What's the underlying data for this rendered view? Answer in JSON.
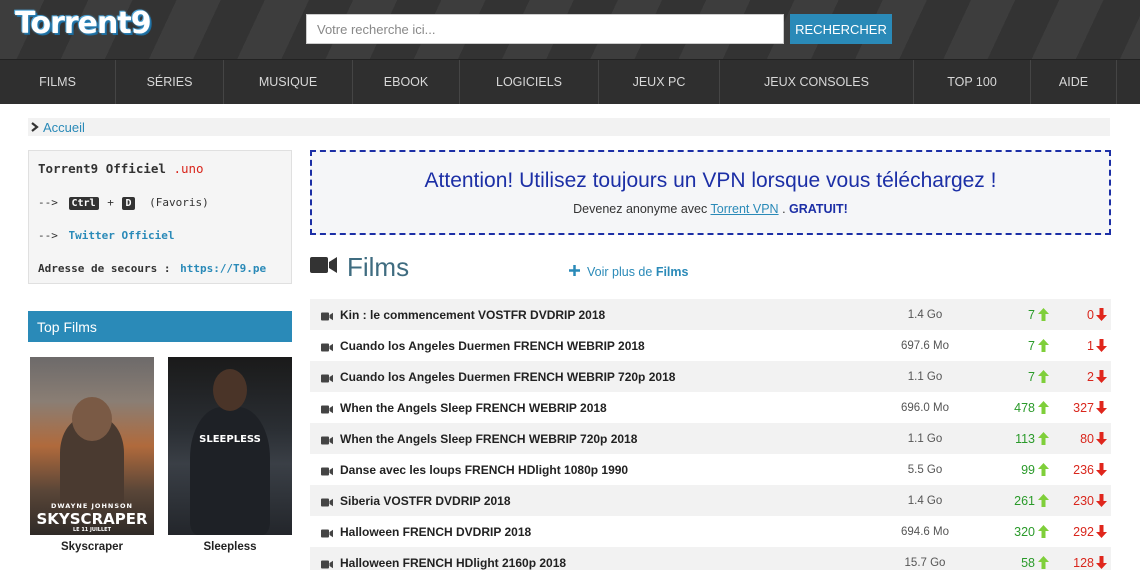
{
  "header": {
    "logo": "Torrent9",
    "search_placeholder": "Votre recherche ici...",
    "search_button": "RECHERCHER"
  },
  "nav": [
    "FILMS",
    "SÉRIES",
    "MUSIQUE",
    "EBOOK",
    "LOGICIELS",
    "JEUX PC",
    "JEUX CONSOLES",
    "TOP 100",
    "AIDE"
  ],
  "breadcrumb": {
    "label": "Accueil"
  },
  "infobox": {
    "title": "Torrent9 Officiel",
    "title_suffix": ".uno",
    "fav_prefix": "-->",
    "key_ctrl": "Ctrl",
    "plus": "+",
    "key_d": "D",
    "fav_label": "(Favoris)",
    "twitter_prefix": "-->",
    "twitter_label": "Twitter Officiel",
    "backup_label": "Adresse de secours :",
    "backup_url": "https://T9.pe"
  },
  "top_films": {
    "heading": "Top Films",
    "items": [
      {
        "caption": "Skyscraper",
        "poster_top": "DWAYNE JOHNSON",
        "poster_title": "SKYSCRAPER",
        "poster_sub": "LE 11 JUILLET"
      },
      {
        "caption": "Sleepless",
        "poster_title": "SLEEPLESS"
      }
    ]
  },
  "vpn": {
    "title": "Attention! Utilisez toujours un VPN lorsque vous téléchargez !",
    "sub_before": "Devenez anonyme avec",
    "link": "Torrent VPN",
    "sub_mid": ".",
    "free": "GRATUIT!"
  },
  "films": {
    "heading": "Films",
    "more_prefix": "Voir plus de",
    "more_bold": "Films"
  },
  "torrents": [
    {
      "title": "Kin : le commencement VOSTFR DVDRIP 2018",
      "size": "1.4 Go",
      "seeders": "7",
      "leechers": "0"
    },
    {
      "title": "Cuando los Angeles Duermen FRENCH WEBRIP 2018",
      "size": "697.6 Mo",
      "seeders": "7",
      "leechers": "1"
    },
    {
      "title": "Cuando los Angeles Duermen FRENCH WEBRIP 720p 2018",
      "size": "1.1 Go",
      "seeders": "7",
      "leechers": "2"
    },
    {
      "title": "When the Angels Sleep FRENCH WEBRIP 2018",
      "size": "696.0 Mo",
      "seeders": "478",
      "leechers": "327"
    },
    {
      "title": "When the Angels Sleep FRENCH WEBRIP 720p 2018",
      "size": "1.1 Go",
      "seeders": "113",
      "leechers": "80"
    },
    {
      "title": "Danse avec les loups FRENCH HDlight 1080p 1990",
      "size": "5.5 Go",
      "seeders": "99",
      "leechers": "236"
    },
    {
      "title": "Siberia VOSTFR DVDRIP 2018",
      "size": "1.4 Go",
      "seeders": "261",
      "leechers": "230"
    },
    {
      "title": "Halloween FRENCH DVDRIP 2018",
      "size": "694.6 Mo",
      "seeders": "320",
      "leechers": "292"
    },
    {
      "title": "Halloween FRENCH HDlight 2160p 2018",
      "size": "15.7 Go",
      "seeders": "58",
      "leechers": "128"
    }
  ],
  "colors": {
    "accent": "#2a8ab8",
    "seed": "#2a9a2a",
    "leech": "#d9261c",
    "vpn": "#1c2fa6"
  },
  "icons": {
    "row": "video-camera-icon",
    "seed": "arrow-up-icon",
    "leech": "arrow-down-icon",
    "more": "plus-icon",
    "breadcrumb": "chevron-right-icon"
  }
}
